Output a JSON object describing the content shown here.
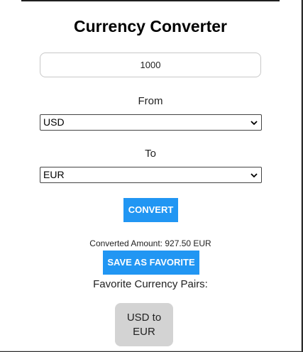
{
  "app": {
    "title": "Currency Converter"
  },
  "amount_input": {
    "value": "1000"
  },
  "from": {
    "label": "From",
    "selected": "USD"
  },
  "to": {
    "label": "To",
    "selected": "EUR"
  },
  "convert_button": {
    "label": "CONVERT"
  },
  "result": {
    "text": "Converted Amount: 927.50 EUR"
  },
  "save_button": {
    "label": "SAVE AS FAVORITE"
  },
  "favorites": {
    "title": "Favorite Currency Pairs:",
    "items": [
      {
        "label": "USD to EUR"
      }
    ]
  },
  "colors": {
    "accent": "#2196f3",
    "favorite_bg": "#d3d3d3"
  },
  "icons": {
    "select_arrow": "chevron-down-icon"
  }
}
